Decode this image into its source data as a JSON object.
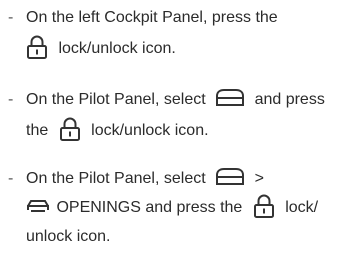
{
  "instructions": [
    {
      "bullet": "-",
      "line1_text": "On the left Cockpit Panel, press the",
      "line2_icon": "lock-icon",
      "line2_text": "lock/unlock icon."
    },
    {
      "bullet": "-",
      "line1_text_a": "On the Pilot Panel, select",
      "line1_icon": "car-roof-icon",
      "line1_text_b": "and press",
      "line2_text_a": "the",
      "line2_icon": "lock-icon",
      "line2_text_b": "lock/unlock icon."
    },
    {
      "bullet": "-",
      "line1_text_a": "On the Pilot Panel, select",
      "line1_icon": "car-roof-icon",
      "line1_text_b": ">",
      "line2_icon_a": "car-openings-icon",
      "line2_text_a": "OPENINGS and press the",
      "line2_icon_b": "lock-icon",
      "line2_text_b": "lock/",
      "line3_text": "unlock icon."
    }
  ]
}
